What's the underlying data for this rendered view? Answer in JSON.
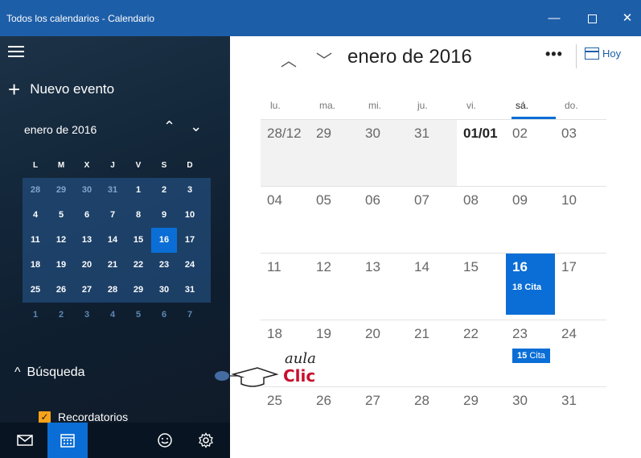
{
  "window": {
    "title": "Todos los calendarios - Calendario",
    "minimize": "—",
    "close": "✕"
  },
  "sidebar": {
    "new_event_label": "Nuevo evento",
    "mini_calendar": {
      "title": "enero de 2016",
      "weekday_headers": [
        "L",
        "M",
        "X",
        "J",
        "V",
        "S",
        "D"
      ],
      "weeks": [
        [
          "28",
          "29",
          "30",
          "31",
          "1",
          "2",
          "3"
        ],
        [
          "4",
          "5",
          "6",
          "7",
          "8",
          "9",
          "10"
        ],
        [
          "11",
          "12",
          "13",
          "14",
          "15",
          "16",
          "17"
        ],
        [
          "18",
          "19",
          "20",
          "21",
          "22",
          "23",
          "24"
        ],
        [
          "25",
          "26",
          "27",
          "28",
          "29",
          "30",
          "31"
        ],
        [
          "1",
          "2",
          "3",
          "4",
          "5",
          "6",
          "7"
        ]
      ],
      "today": "16"
    },
    "search_label": "Búsqueda",
    "reminders_label": "Recordatorios"
  },
  "main": {
    "month_title": "enero de 2016",
    "more_label": "•••",
    "today_label": "Hoy",
    "weekdays": [
      "lu.",
      "ma.",
      "mi.",
      "ju.",
      "vi.",
      "sá.",
      "do."
    ],
    "weeks": [
      [
        "28/12",
        "29",
        "30",
        "31",
        "01/01",
        "02",
        "03"
      ],
      [
        "04",
        "05",
        "06",
        "07",
        "08",
        "09",
        "10"
      ],
      [
        "11",
        "12",
        "13",
        "14",
        "15",
        "16",
        "17"
      ],
      [
        "18",
        "19",
        "20",
        "21",
        "22",
        "23",
        "24"
      ],
      [
        "25",
        "26",
        "27",
        "28",
        "29",
        "30",
        "31"
      ]
    ],
    "events": {
      "w2_sat": {
        "time": "18",
        "label": "Cita"
      },
      "w3_sat": {
        "time": "15",
        "label": "Cita"
      }
    }
  },
  "watermark": {
    "line1": "aula",
    "line2": "Clic"
  },
  "colors": {
    "accent": "#0a6ed6",
    "titlebar": "#1d5ea8",
    "checkbox": "#f7a21a"
  }
}
